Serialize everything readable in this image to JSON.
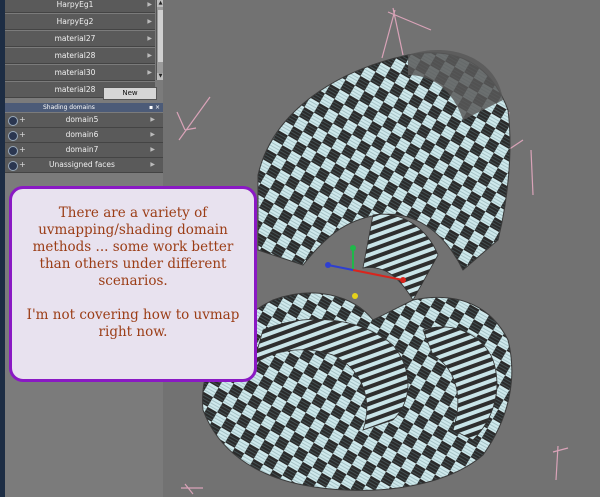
{
  "materials": {
    "items": [
      "HarpyEg1",
      "HarpyEg2",
      "material27",
      "material28",
      "material30",
      "material28"
    ],
    "new_label": "New"
  },
  "shading_domains": {
    "title": "Shading domains",
    "items": [
      "domain5",
      "domain6",
      "domain7",
      "Unassigned faces"
    ]
  },
  "callout": {
    "paragraph1": "There are a variety of uvmapping/shading domain methods ... some work better than others under different scenarios.",
    "paragraph2": "I'm not covering how to uvmap right now."
  },
  "colors": {
    "callout_border": "#8a19c4",
    "callout_text": "#9b3d16",
    "panel_bg": "#7b7b7b",
    "viewport_bg": "#727272"
  }
}
